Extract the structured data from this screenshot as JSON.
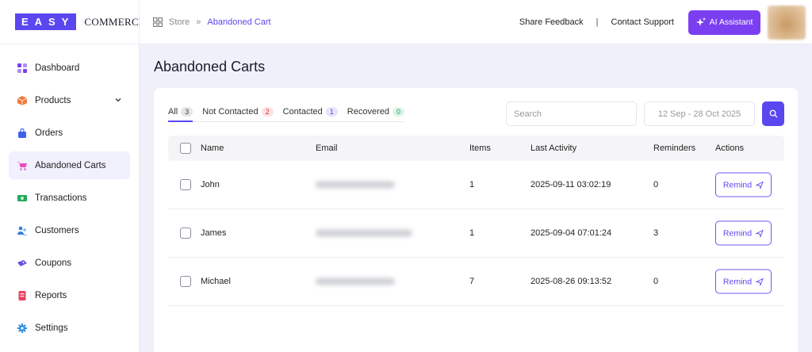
{
  "brand": {
    "box": "EASY",
    "text": "COMMERCE"
  },
  "sidebar": {
    "items": [
      {
        "label": "Dashboard",
        "icon": "dashboard-icon",
        "color": "#7b3ff2"
      },
      {
        "label": "Products",
        "icon": "box-icon",
        "color": "#f07a3a"
      },
      {
        "label": "Orders",
        "icon": "bag-icon",
        "color": "#3b62e8"
      },
      {
        "label": "Abandoned Carts",
        "icon": "cart-icon",
        "color": "#e84ec0"
      },
      {
        "label": "Transactions",
        "icon": "cash-icon",
        "color": "#27a85a"
      },
      {
        "label": "Customers",
        "icon": "users-icon",
        "color": "#2f7fe0"
      },
      {
        "label": "Coupons",
        "icon": "ticket-icon",
        "color": "#6b4fe0"
      },
      {
        "label": "Reports",
        "icon": "report-icon",
        "color": "#e8425a"
      },
      {
        "label": "Settings",
        "icon": "gear-icon",
        "color": "#2f8fe0"
      }
    ]
  },
  "breadcrumb": {
    "root": "Store",
    "separator": "»",
    "current": "Abandoned Cart"
  },
  "header": {
    "feedback": "Share Feedback",
    "divider": "|",
    "support": "Contact Support",
    "ai": "AI Assistant"
  },
  "page": {
    "title": "Abandoned Carts"
  },
  "tabs": [
    {
      "label": "All",
      "count": "3"
    },
    {
      "label": "Not Contacted",
      "count": "2"
    },
    {
      "label": "Contacted",
      "count": "1"
    },
    {
      "label": "Recovered",
      "count": "0"
    }
  ],
  "filters": {
    "search_placeholder": "Search",
    "date_range": "12 Sep - 28 Oct 2025"
  },
  "table": {
    "headers": {
      "name": "Name",
      "email": "Email",
      "items": "Items",
      "last_activity": "Last Activity",
      "reminders": "Reminders",
      "actions": "Actions"
    },
    "rows": [
      {
        "name": "John",
        "items": "1",
        "last_activity": "2025-09-11 03:02:19",
        "reminders": "0",
        "action": "Remind"
      },
      {
        "name": "James",
        "items": "1",
        "last_activity": "2025-09-04 07:01:24",
        "reminders": "3",
        "action": "Remind"
      },
      {
        "name": "Michael",
        "items": "7",
        "last_activity": "2025-08-26 09:13:52",
        "reminders": "0",
        "action": "Remind"
      }
    ]
  },
  "colors": {
    "accent": "#5b47f0",
    "ai_button": "#7b3ff2"
  }
}
